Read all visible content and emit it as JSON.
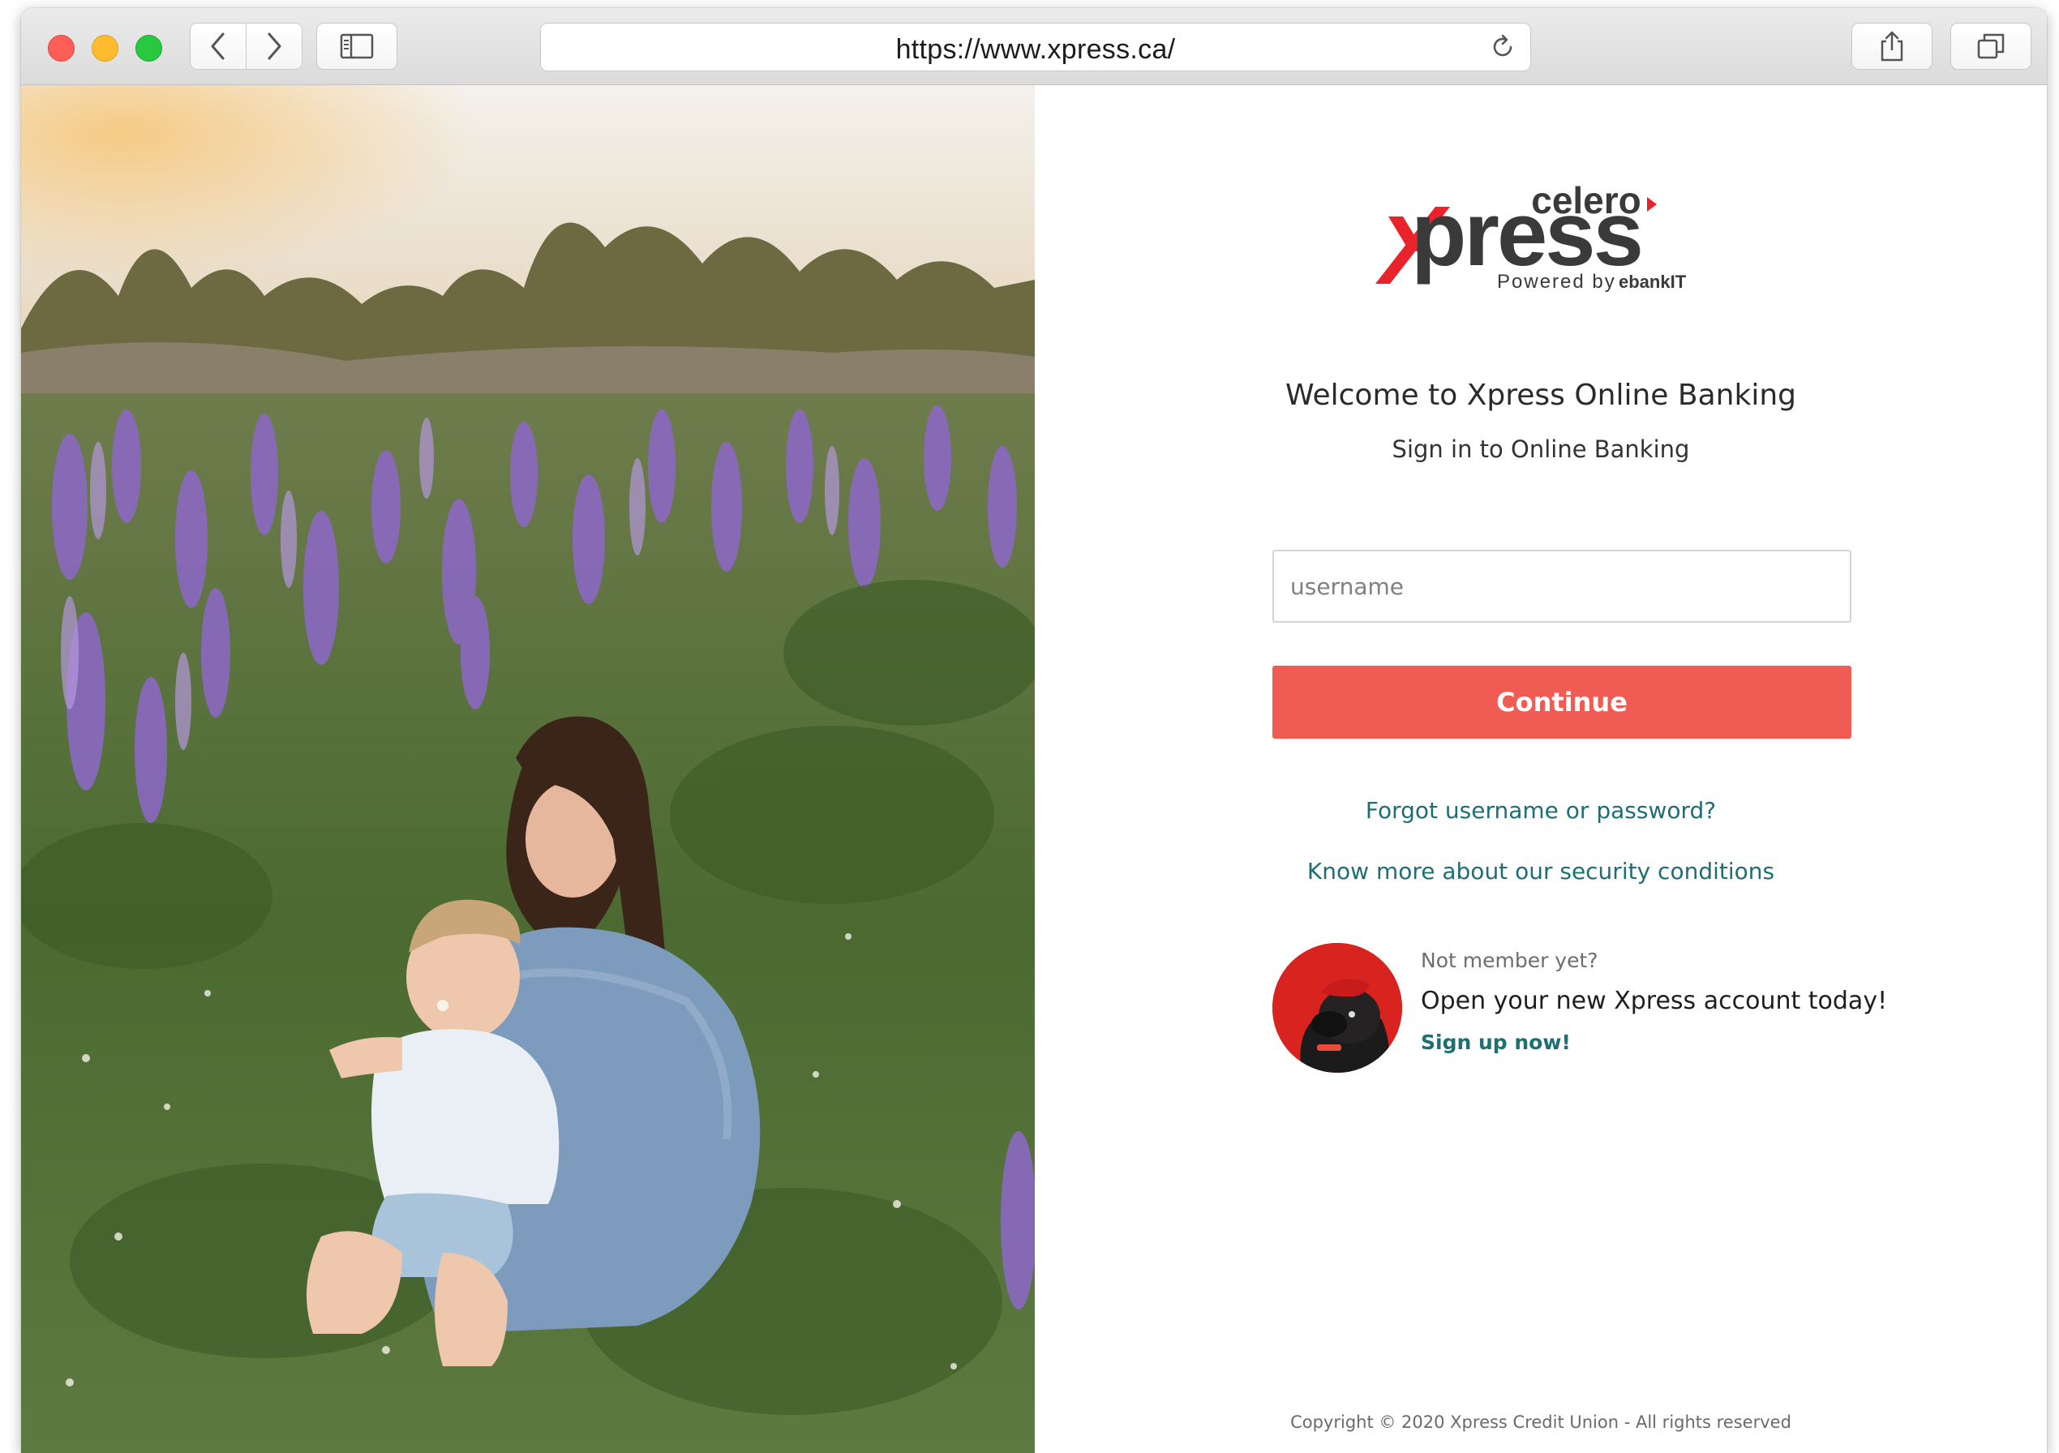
{
  "browser": {
    "url": "https://www.xpress.ca/",
    "icons": {
      "back": "chevron-left-icon",
      "forward": "chevron-right-icon",
      "sidebar": "sidebar-icon",
      "reload": "reload-icon",
      "share": "share-icon",
      "tabs": "tabs-overview-icon"
    }
  },
  "logo": {
    "brand_top": "celero",
    "brand_main": "xpress",
    "powered": "Powered by",
    "powered_brand": "ebankIT",
    "accent_color": "#e8232a"
  },
  "login": {
    "title": "Welcome to Xpress Online Banking",
    "subtitle": "Sign in to Online Banking",
    "username_placeholder": "username",
    "username_value": "",
    "continue_label": "Continue",
    "forgot_link": "Forgot username or password?",
    "security_link": "Know more about our security conditions"
  },
  "promo": {
    "small": "Not member yet?",
    "main": "Open your new Xpress account today!",
    "link": "Sign up now!"
  },
  "footer": {
    "copyright": "Copyright © 2020 Xpress Credit Union  - All rights reserved"
  },
  "colors": {
    "button": "#f05c54",
    "link": "#1f6e74"
  }
}
